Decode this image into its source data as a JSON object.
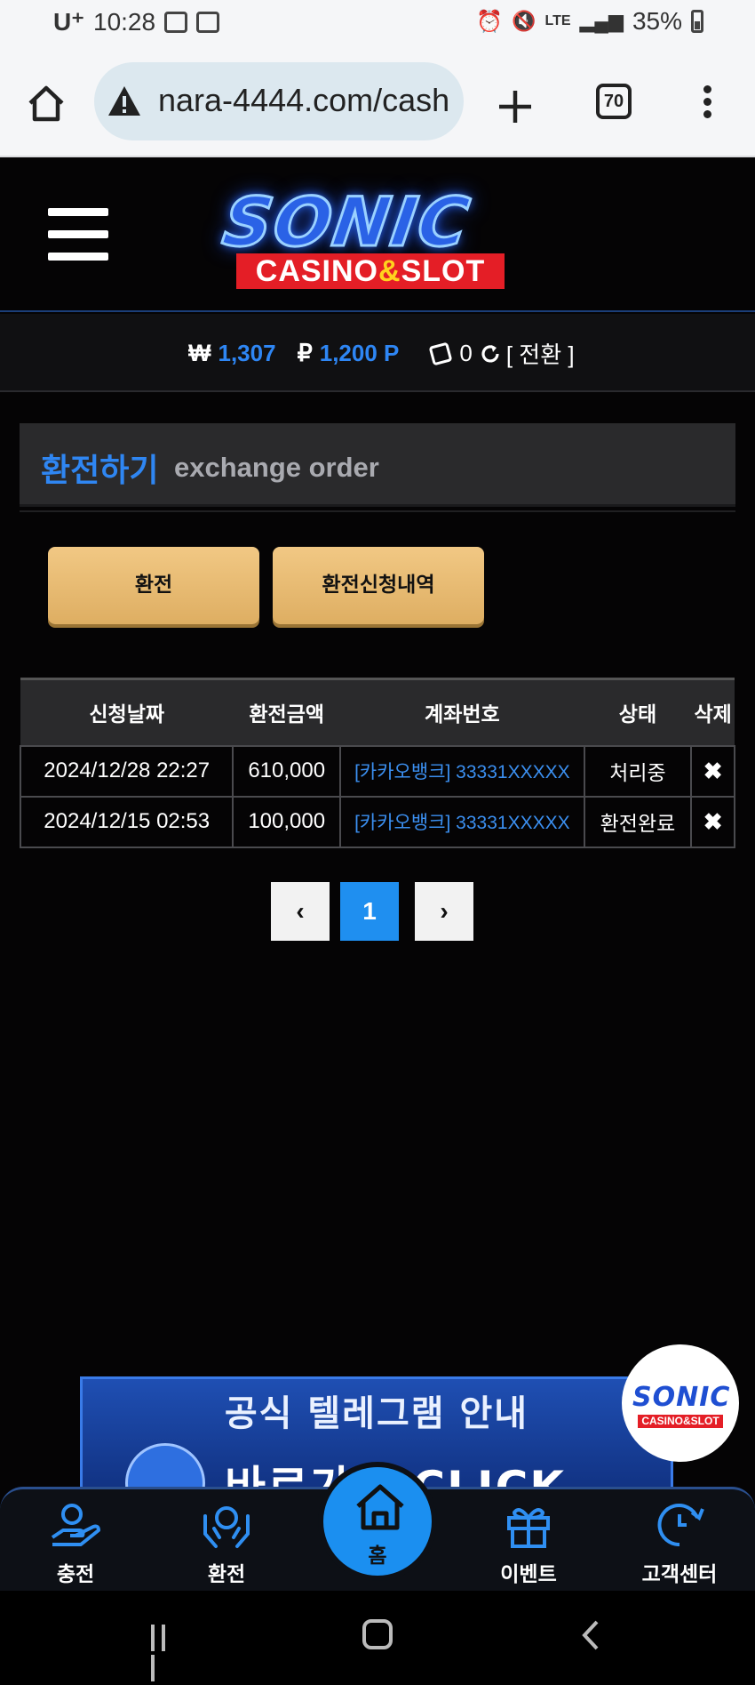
{
  "status_bar": {
    "carrier": "U⁺",
    "time": "10:28",
    "network": "LTE",
    "battery": "35%"
  },
  "browser": {
    "url": "nara-4444.com/cash",
    "tab_count": "70"
  },
  "header": {
    "logo_main": "SONIC",
    "logo_sub_left": "CASINO",
    "logo_sub_amp": "&",
    "logo_sub_right": "SLOT"
  },
  "balance": {
    "won_symbol": "₩",
    "won_value": "1,307",
    "point_symbol": "₽",
    "point_value": "1,200 P",
    "dice_count": "0",
    "convert_label": "[ 전환 ]"
  },
  "panel": {
    "title_ko": "환전하기",
    "title_en": "exchange order"
  },
  "actions": {
    "exchange_label": "환전",
    "history_label": "환전신청내역"
  },
  "table": {
    "headers": [
      "신청날짜",
      "환전금액",
      "계좌번호",
      "상태",
      "삭제"
    ],
    "rows": [
      {
        "date": "2024/12/28 22:27",
        "amount": "610,000",
        "account": "[카카오뱅크] 33331XXXXX",
        "status": "처리중",
        "delete": "✖"
      },
      {
        "date": "2024/12/15 02:53",
        "amount": "100,000",
        "account": "[카카오뱅크] 33331XXXXX",
        "status": "환전완료",
        "delete": "✖"
      }
    ]
  },
  "pagination": {
    "prev": "‹",
    "current": "1",
    "next": "›"
  },
  "banner": {
    "title": "공식 텔레그램 안내",
    "subtitle": "바로가기 CLICK"
  },
  "floating_logo": {
    "main": "SONIC",
    "sub": "CASINO&SLOT"
  },
  "bottom_nav": {
    "charge": "충전",
    "exchange": "환전",
    "home": "홈",
    "event": "이벤트",
    "support": "고객센터"
  },
  "colors": {
    "accent_blue": "#2e86f4",
    "gold_button": "#e8bb72",
    "page_bg": "#050405"
  }
}
